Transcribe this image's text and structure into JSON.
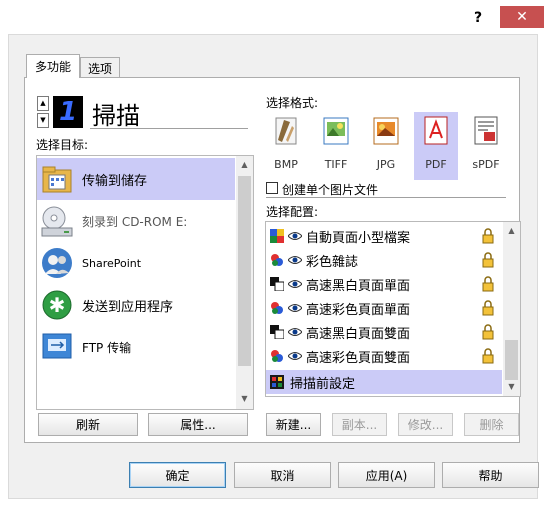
{
  "window": {
    "help_btn": "?",
    "close_btn": "✕"
  },
  "tabs": [
    "多功能",
    "选项"
  ],
  "scanner": {
    "number": "1",
    "name": "掃描"
  },
  "labels": {
    "destination": "选择目标:",
    "format": "选择格式:",
    "config": "选择配置:"
  },
  "destinations": [
    {
      "label": "传输到储存",
      "icon": "folder-icon",
      "selected": true
    },
    {
      "label": "刻录到 CD-ROM E:",
      "icon": "cd-drive-icon"
    },
    {
      "label": "SharePoint",
      "icon": "sharepoint-icon"
    },
    {
      "label": "发送到应用程序",
      "icon": "send-to-app-icon"
    },
    {
      "label": "FTP 传输",
      "icon": "ftp-icon"
    }
  ],
  "formats": [
    {
      "label": "BMP"
    },
    {
      "label": "TIFF"
    },
    {
      "label": "JPG"
    },
    {
      "label": "PDF",
      "selected": true
    },
    {
      "label": "sPDF"
    }
  ],
  "single_image_checkbox": "创建单个图片文件",
  "configs": [
    {
      "label": "自動頁面小型檔案",
      "color": "color"
    },
    {
      "label": "彩色雜誌",
      "color": "color"
    },
    {
      "label": "高速黑白頁面單面",
      "color": "bw"
    },
    {
      "label": "高速彩色頁面單面",
      "color": "color"
    },
    {
      "label": "高速黑白頁面雙面",
      "color": "bw"
    },
    {
      "label": "高速彩色頁面雙面",
      "color": "color"
    },
    {
      "label": "掃描前設定",
      "color": "pre",
      "selected": true
    }
  ],
  "left_buttons": {
    "refresh": "刷新",
    "properties": "属性..."
  },
  "config_buttons": {
    "new": "新建...",
    "copy": "副本...",
    "edit": "修改...",
    "delete": "删除"
  },
  "footer_buttons": {
    "ok": "确定",
    "cancel": "取消",
    "apply": "应用(A)",
    "help": "帮助"
  },
  "colors": {
    "selection": "#cbcbf7",
    "close": "#c75050",
    "accent": "#3c7fb1"
  }
}
